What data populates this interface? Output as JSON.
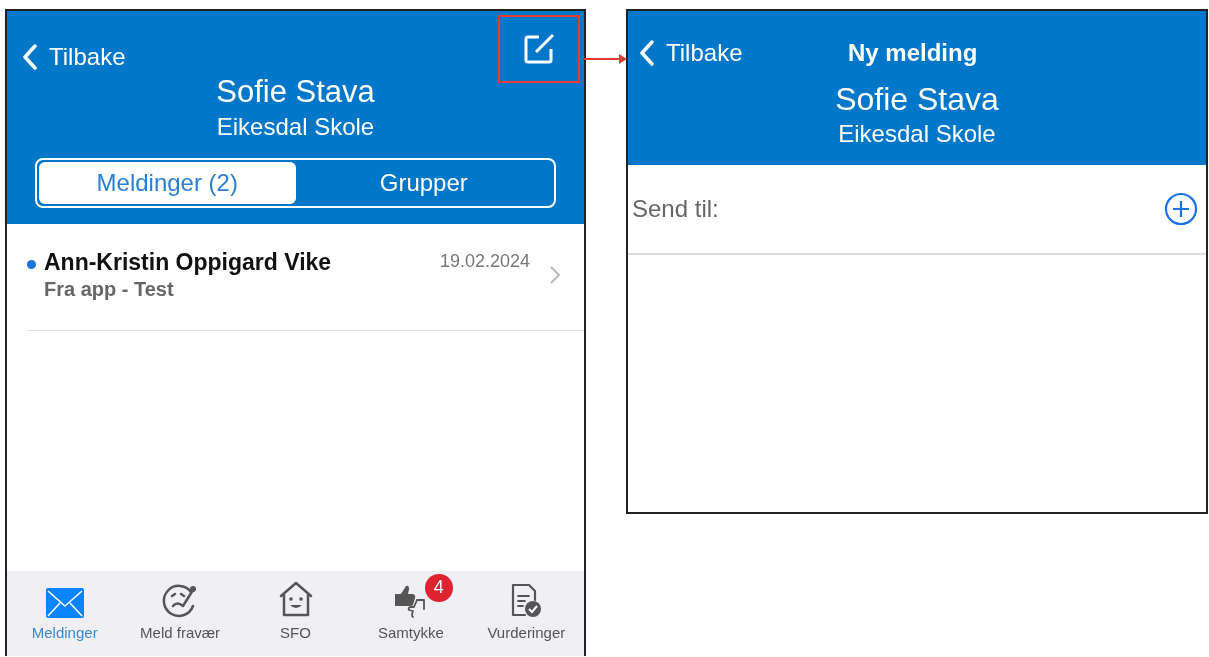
{
  "list_screen": {
    "back": "Tilbake",
    "compose_highlighted": true,
    "name": "Sofie Stava",
    "school": "Eikesdal Skole",
    "segments": [
      {
        "label": "Meldinger (2)",
        "selected": true
      },
      {
        "label": "Grupper",
        "selected": false
      }
    ],
    "messages": [
      {
        "sender": "Ann-Kristin Oppigard Vike",
        "subject": "Fra app - Test",
        "date": "19.02.2024",
        "unread": true
      }
    ],
    "tabs": [
      {
        "label": "Meldinger",
        "kind": "mail",
        "selected": true
      },
      {
        "label": "Meld fravær",
        "kind": "absence",
        "selected": false
      },
      {
        "label": "SFO",
        "kind": "house",
        "selected": false
      },
      {
        "label": "Samtykke",
        "kind": "consent",
        "selected": false,
        "badge": "4"
      },
      {
        "label": "Vurderinger",
        "kind": "assessment",
        "selected": false
      }
    ]
  },
  "compose_screen": {
    "back": "Tilbake",
    "title": "Ny melding",
    "name": "Sofie Stava",
    "school": "Eikesdal Skole",
    "recipient_label": "Send til:"
  }
}
